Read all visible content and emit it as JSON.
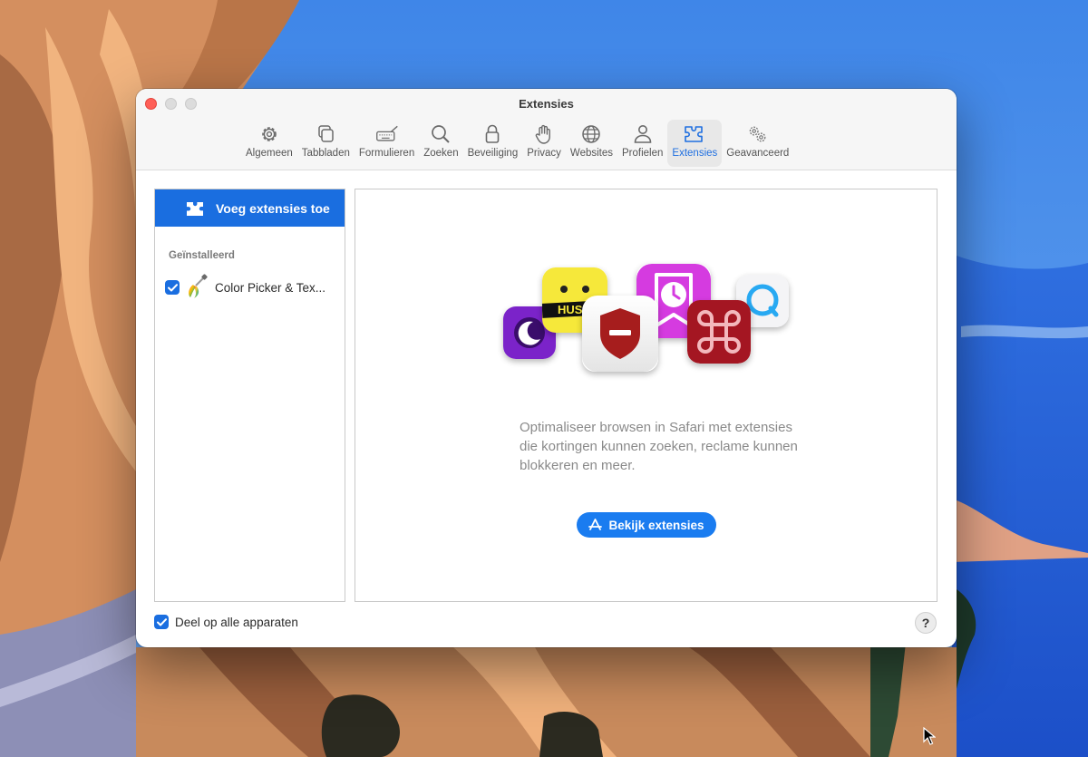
{
  "window": {
    "title": "Extensies"
  },
  "toolbar": {
    "tabs": [
      {
        "label": "Algemeen",
        "icon": "gear-icon"
      },
      {
        "label": "Tabbladen",
        "icon": "tabs-icon"
      },
      {
        "label": "Formulieren",
        "icon": "keyboard-pen-icon"
      },
      {
        "label": "Zoeken",
        "icon": "search-icon"
      },
      {
        "label": "Beveiliging",
        "icon": "lock-icon"
      },
      {
        "label": "Privacy",
        "icon": "hand-icon"
      },
      {
        "label": "Websites",
        "icon": "globe-icon"
      },
      {
        "label": "Profielen",
        "icon": "person-icon"
      },
      {
        "label": "Extensies",
        "icon": "puzzle-icon",
        "active": true
      },
      {
        "label": "Geavanceerd",
        "icon": "gears-icon"
      }
    ]
  },
  "sidebar": {
    "add_label": "Voeg extensies toe",
    "section_title": "Geïnstalleerd",
    "extensions": [
      {
        "name": "Color Picker & Tex...",
        "enabled": true,
        "icon": "color-picker-icon"
      }
    ]
  },
  "main": {
    "description": "Optimaliseer browsen in Safari met extensies die kortingen kunnen zoeken, reclame kunnen blokkeren en meer.",
    "view_button_label": "Bekijk extensies",
    "featured_icons": [
      "moon-app-icon",
      "hush-app-icon",
      "shield-app-icon",
      "clock-bookmark-app-icon",
      "command-app-icon",
      "search-bubble-app-icon"
    ],
    "hush_text": "HUSH"
  },
  "footer": {
    "share_label": "Deel op alle apparaten",
    "share_checked": true,
    "help_label": "?"
  },
  "colors": {
    "accent": "#1a6ee0",
    "close": "#ff5f57"
  }
}
